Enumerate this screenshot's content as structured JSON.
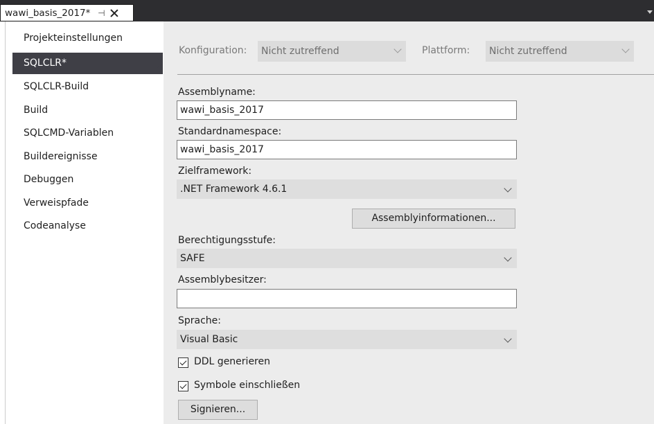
{
  "tab": {
    "title": "wawi_basis_2017*",
    "pin_icon": "pin-icon",
    "close_icon": "close-icon"
  },
  "sidebar": {
    "items": [
      {
        "label": "Projekteinstellungen"
      },
      {
        "label": "SQLCLR*",
        "selected": true
      },
      {
        "label": "SQLCLR-Build"
      },
      {
        "label": "Build"
      },
      {
        "label": "SQLCMD-Variablen"
      },
      {
        "label": "Buildereignisse"
      },
      {
        "label": "Debuggen"
      },
      {
        "label": "Verweispfade"
      },
      {
        "label": "Codeanalyse"
      }
    ]
  },
  "config": {
    "configuration_label": "Konfiguration:",
    "configuration_value": "Nicht zutreffend",
    "platform_label": "Plattform:",
    "platform_value": "Nicht zutreffend"
  },
  "form": {
    "assemblyname_label": "Assemblyname:",
    "assemblyname_value": "wawi_basis_2017",
    "namespace_label": "Standardnamespace:",
    "namespace_value": "wawi_basis_2017",
    "framework_label": "Zielframework:",
    "framework_value": ".NET Framework 4.6.1",
    "assemblyinfo_button": "Assemblyinformationen...",
    "permission_label": "Berechtigungsstufe:",
    "permission_value": "SAFE",
    "owner_label": "Assemblybesitzer:",
    "owner_value": "",
    "language_label": "Sprache:",
    "language_value": "Visual Basic",
    "ddl_label": "DDL generieren",
    "ddl_checked": true,
    "symbols_label": "Symbole einschließen",
    "symbols_checked": true,
    "sign_button": "Signieren..."
  },
  "colors": {
    "tabstrip": "#2d2d30",
    "selected_nav": "#3f3f46",
    "panel": "#ececec"
  }
}
